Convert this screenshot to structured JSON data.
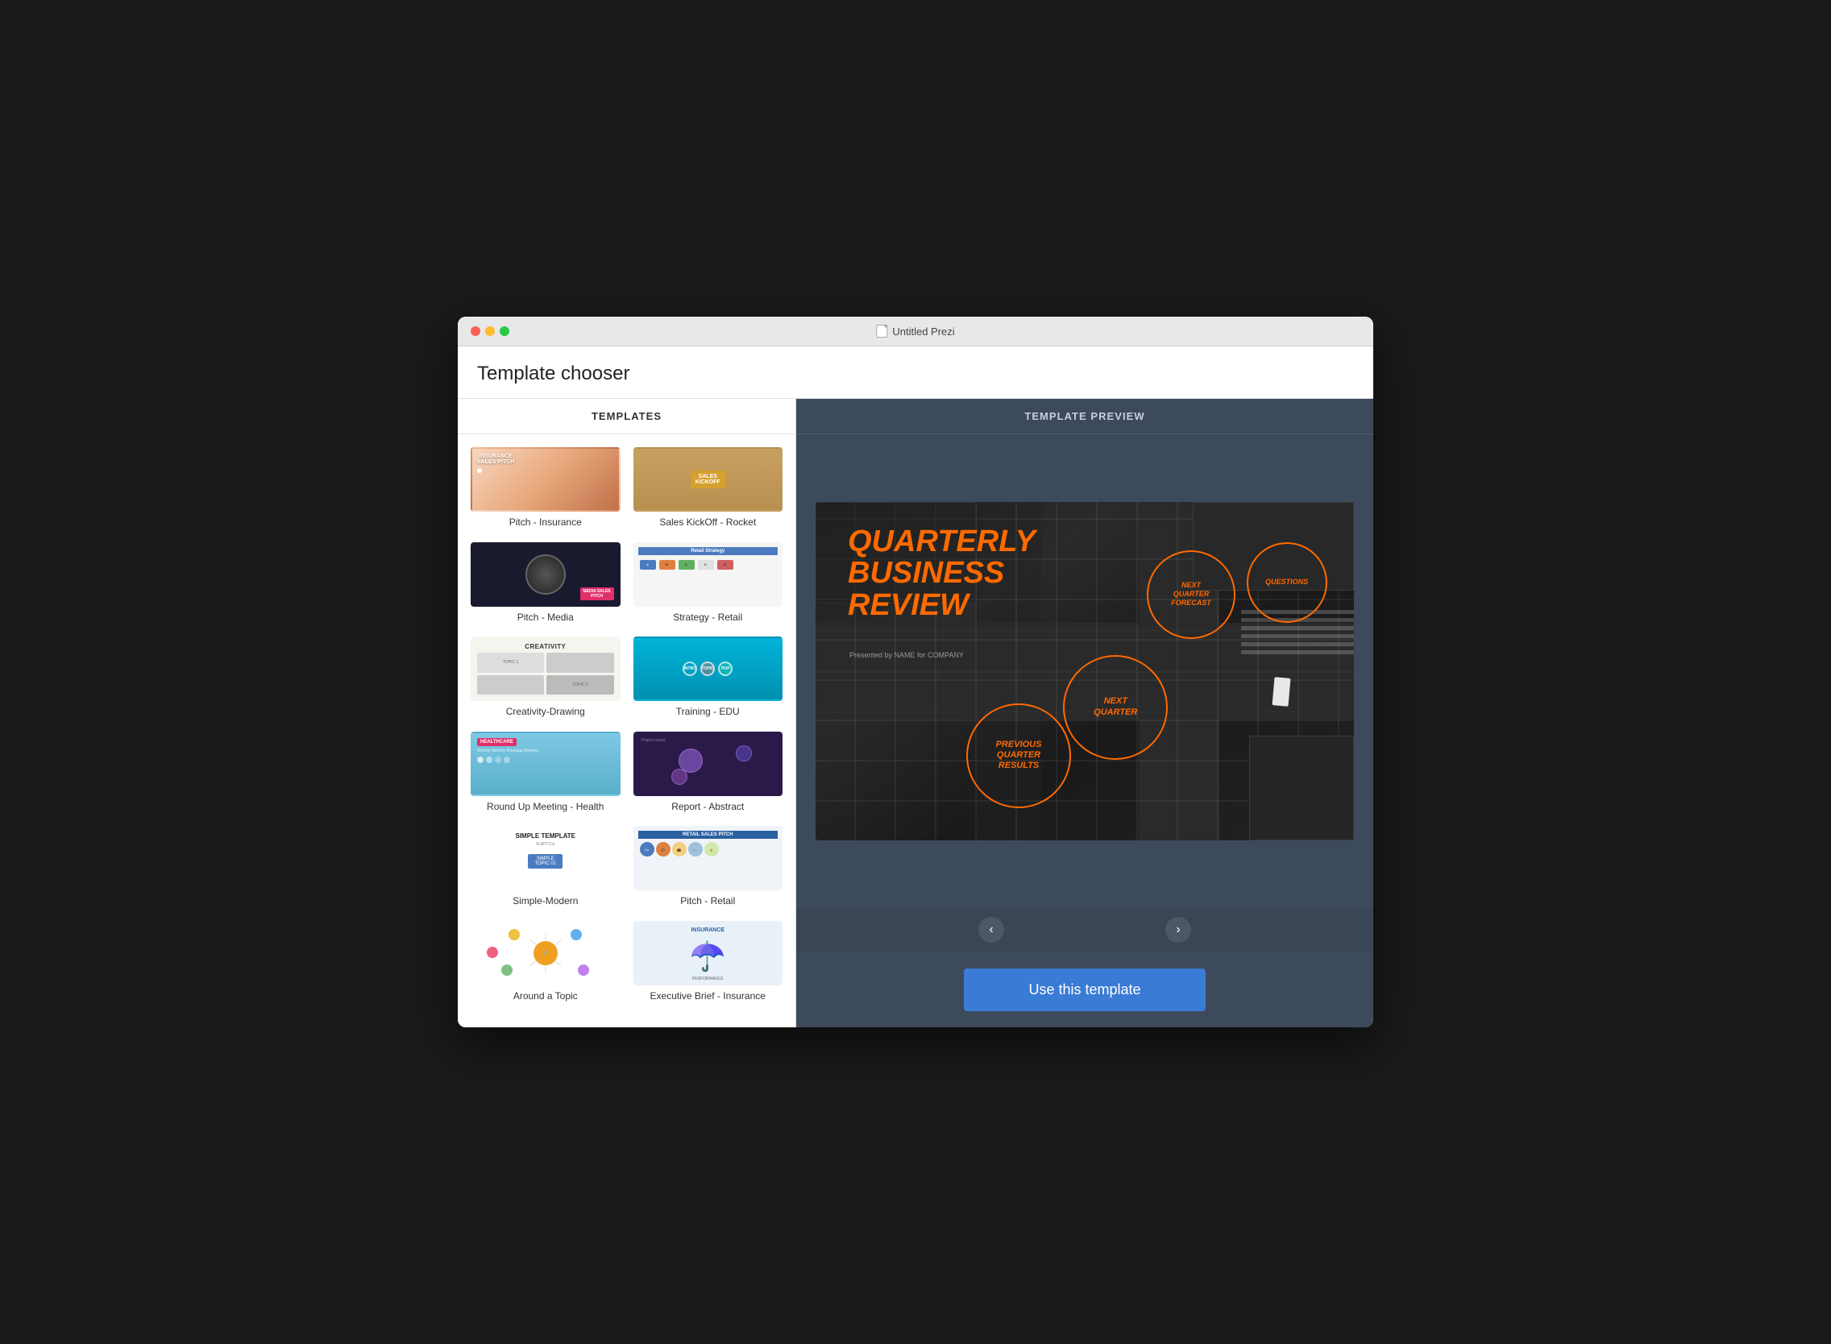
{
  "window": {
    "title": "Untitled Prezi",
    "title_label": "Untitled Prezi"
  },
  "header": {
    "title": "Template chooser"
  },
  "templates_panel": {
    "heading": "TEMPLATES"
  },
  "preview_panel": {
    "heading": "TEMPLATE PREVIEW",
    "nav_prev": "‹",
    "nav_next": "›",
    "use_button": "Use this template"
  },
  "preview": {
    "title_line1": "QUARTERLY",
    "title_line2": "BUSINESS",
    "title_line3": "REVIEW",
    "subtitle": "Presented by NAME for COMPANY",
    "circles": [
      {
        "label": "NEXT\nQUARTER",
        "id": "next-quarter"
      },
      {
        "label": "PREVIOUS\nQUARTER\nRESULTS",
        "id": "prev-quarter"
      },
      {
        "label": "NEXT\nQUARTER\nFORECAST",
        "id": "forecast"
      },
      {
        "label": "QUESTIONS",
        "id": "questions"
      }
    ]
  },
  "templates": [
    {
      "id": "pitch-insurance",
      "label": "Pitch - Insurance"
    },
    {
      "id": "sales-kickoff",
      "label": "Sales KickOff - Rocket"
    },
    {
      "id": "pitch-media",
      "label": "Pitch - Media"
    },
    {
      "id": "strategy-retail",
      "label": "Strategy - Retail"
    },
    {
      "id": "creativity-drawing",
      "label": "Creativity-Drawing"
    },
    {
      "id": "training-edu",
      "label": "Training - EDU"
    },
    {
      "id": "round-up-health",
      "label": "Round Up Meeting - Health"
    },
    {
      "id": "report-abstract",
      "label": "Report - Abstract"
    },
    {
      "id": "simple-modern",
      "label": "Simple-Modern"
    },
    {
      "id": "pitch-retail",
      "label": "Pitch - Retail"
    },
    {
      "id": "around-topic",
      "label": "Around a Topic"
    },
    {
      "id": "exec-brief-insurance",
      "label": "Executive Brief - Insurance"
    }
  ]
}
